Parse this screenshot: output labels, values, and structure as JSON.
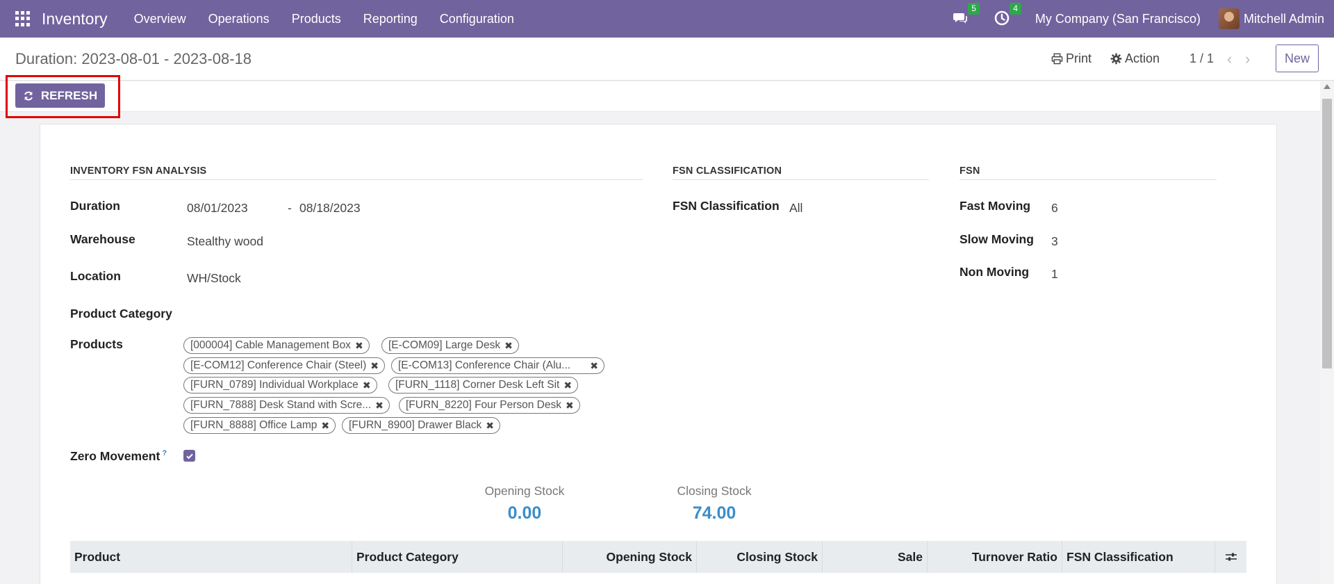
{
  "navbar": {
    "brand": "Inventory",
    "menu": [
      "Overview",
      "Operations",
      "Products",
      "Reporting",
      "Configuration"
    ],
    "messages_badge": "5",
    "activities_badge": "4",
    "company": "My Company (San Francisco)",
    "user": "Mitchell Admin"
  },
  "control_panel": {
    "title": "Duration: 2023-08-01 - 2023-08-18",
    "print_label": "Print",
    "action_label": "Action",
    "pager": "1 / 1",
    "new_label": "New"
  },
  "button_bar": {
    "refresh_label": "REFRESH"
  },
  "form": {
    "analysis_title": "INVENTORY FSN ANALYSIS",
    "classification_title": "FSN CLASSIFICATION",
    "fsn_title": "FSN",
    "duration_label": "Duration",
    "duration_start": "08/01/2023",
    "duration_sep": "-",
    "duration_end": "08/18/2023",
    "warehouse_label": "Warehouse",
    "warehouse_value": "Stealthy wood",
    "location_label": "Location",
    "location_value": "WH/Stock",
    "product_category_label": "Product Category",
    "products_label": "Products",
    "products": [
      "[000004] Cable Management Box",
      "[E-COM09] Large Desk",
      "[E-COM12] Conference Chair (Steel)",
      "[E-COM13] Conference Chair (Alu...",
      "[FURN_0789] Individual Workplace",
      "[FURN_1118] Corner Desk Left Sit",
      "[FURN_7888] Desk Stand with Scre...",
      "[FURN_8220] Four Person Desk",
      "[FURN_8888] Office Lamp",
      "[FURN_8900] Drawer Black"
    ],
    "zero_movement_label": "Zero Movement",
    "zero_movement_help": "?",
    "zero_movement_checked": true,
    "fsn_classification_label": "FSN Classification",
    "fsn_classification_value": "All",
    "fast_moving_label": "Fast Moving",
    "fast_moving_value": "6",
    "slow_moving_label": "Slow Moving",
    "slow_moving_value": "3",
    "non_moving_label": "Non Moving",
    "non_moving_value": "1",
    "opening_stock_label": "Opening Stock",
    "opening_stock_value": "0.00",
    "closing_stock_label": "Closing Stock",
    "closing_stock_value": "74.00"
  },
  "table": {
    "columns": [
      "Product",
      "Product Category",
      "Opening Stock",
      "Closing Stock",
      "Sale",
      "Turnover Ratio",
      "FSN Classification"
    ]
  },
  "colors": {
    "brand": "#71639e",
    "badge": "#2ea84c",
    "stat_value": "#3c8dcb",
    "highlight": "#e00000"
  }
}
